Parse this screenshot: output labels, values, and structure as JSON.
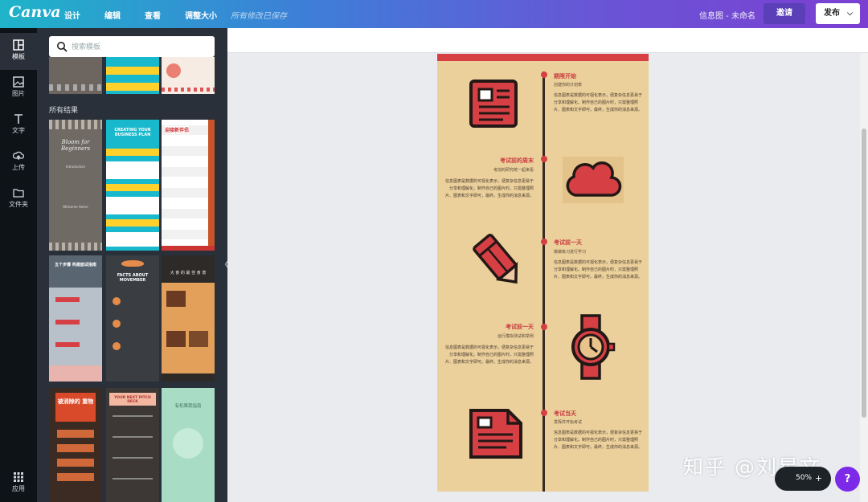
{
  "topbar": {
    "logo": "Canva",
    "menu": [
      "设计",
      "编辑",
      "查看",
      "调整大小"
    ],
    "saved_status": "所有修改已保存",
    "doc_title": "信息图 - 未命名",
    "invite_label": "邀请",
    "publish_label": "发布",
    "gradient_colors": [
      "#1fb4c9",
      "#3d7fd8",
      "#6a54d6",
      "#7b3fd1"
    ]
  },
  "rail": {
    "items": [
      {
        "label": "模板",
        "icon": "template-icon"
      },
      {
        "label": "图片",
        "icon": "image-icon"
      },
      {
        "label": "文字",
        "icon": "text-icon"
      },
      {
        "label": "上传",
        "icon": "upload-icon"
      },
      {
        "label": "文件夹",
        "icon": "folder-icon"
      }
    ],
    "apps_label": "应用"
  },
  "panel": {
    "search_placeholder": "搜索模板",
    "section_title": "所有结果",
    "templates": [
      {
        "title": "Bloom for Beginners",
        "lines": [
          "Introduction",
          "Welcome Home"
        ]
      },
      {
        "title": "CREATING YOUR BUSINESS PLAN"
      },
      {
        "title": "迎接新伴侣"
      },
      {
        "title": "五个步骤 构建面试指南"
      },
      {
        "title": "FACTS ABOUT MOVEMBER"
      },
      {
        "title": "大 食 的 最 佳 食 谱"
      },
      {
        "title": "被消除的 重物"
      },
      {
        "title": "YOUR NEXT PITCH DECK"
      },
      {
        "title": "有机果蔬指南"
      }
    ]
  },
  "infographic": {
    "accent_color": "#d64045",
    "background_color": "#ebd09b",
    "steps": [
      {
        "heading": "期限开始",
        "sub": "创建你的计划表",
        "icon": "newspaper-icon"
      },
      {
        "heading": "考试前的周末",
        "sub": "考前的研究统一起来看",
        "body": "信息图表是数据的可视化表示，便复杂信息更易于分享和理解化。制作自己的图片时，只需整理照片、图表和文字即可，最终，生成你的消息来源。",
        "icon": "cloud-icon"
      },
      {
        "heading": "考试前一天",
        "sub": "做做练习进行学习",
        "body": "信息图表是数据的可视化表示，便复杂信息更易于分享和理解化。制作自己的图片时，只需整理照片、图表和文字即可。最终，生成你的消息来源。",
        "icon": "pencil-icon"
      },
      {
        "heading": "考试前一天",
        "sub": "运行模拟测试和举例",
        "body": "信息图表是数据的可视化表示，便复杂信息更易于分享和理解化。制作自己的图片时，只需整理照片、图表和文字即可。最终，生成你的消息来源。",
        "icon": "watch-icon"
      },
      {
        "heading": "考试当天",
        "sub": "发挥并开始考试",
        "body": "信息图表是数据的可视化表示，便复杂信息更易于分享和理解化。制作自己的图片时，只需整理照片、图表和文字即可。最终，生成你的消息来源。",
        "icon": "document-icon"
      }
    ],
    "first_body": "信息图表是数据的可视化表示，便复杂信息更易于分享和理解化。制作自己的图片时，只需整理照片、图表和文字即可。最终，生成你的消息来源。"
  },
  "footer": {
    "watermark": "知乎 @刘星文",
    "zoom": "50%",
    "zoom_plus": "+",
    "help": "?"
  }
}
